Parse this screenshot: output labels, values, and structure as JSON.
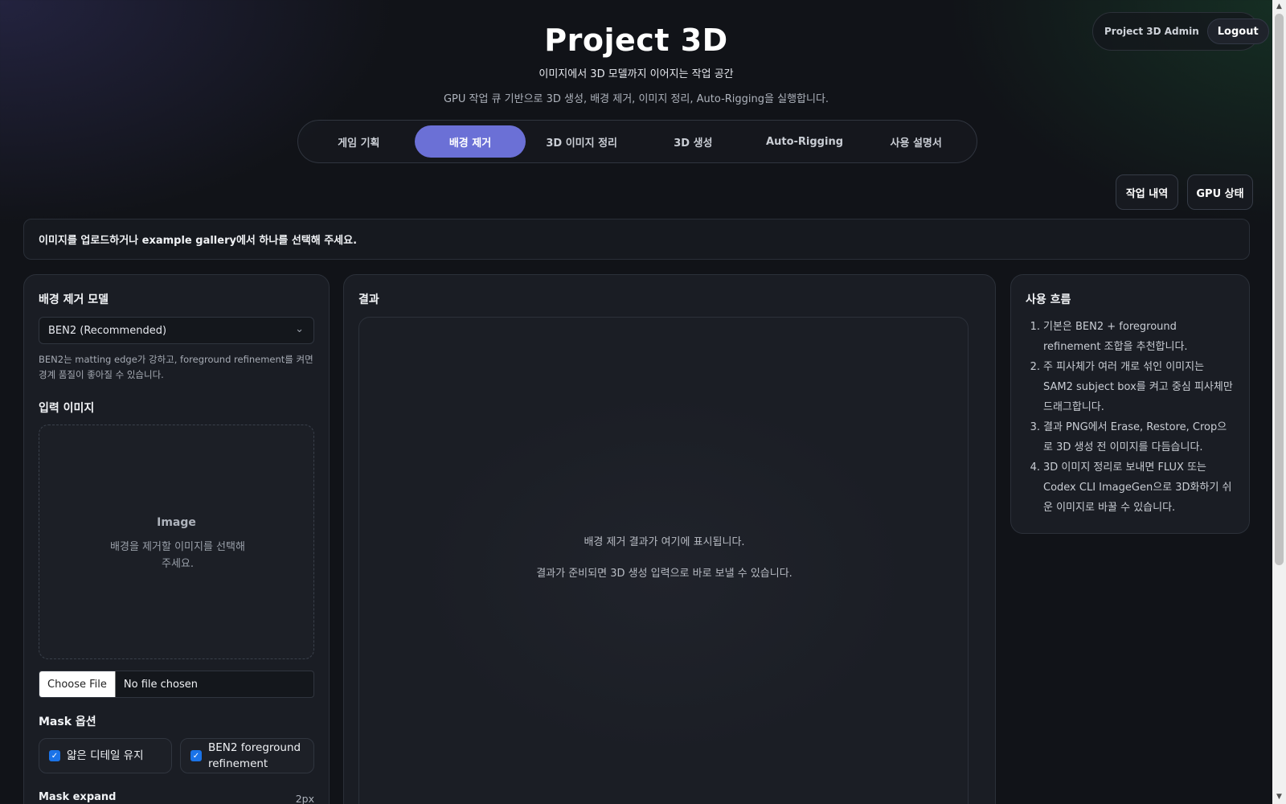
{
  "header": {
    "title": "Project 3D",
    "subtitle": "이미지에서 3D 모델까지 이어지는 작업 공간",
    "description": "GPU 작업 큐 기반으로 3D 생성, 배경 제거, 이미지 정리, Auto-Rigging을 실행합니다."
  },
  "user": {
    "name": "Project 3D Admin",
    "logout_label": "Logout"
  },
  "tabs": [
    {
      "label": "게임 기획",
      "active": false
    },
    {
      "label": "배경 제거",
      "active": true
    },
    {
      "label": "3D 이미지 정리",
      "active": false
    },
    {
      "label": "3D 생성",
      "active": false
    },
    {
      "label": "Auto-Rigging",
      "active": false
    },
    {
      "label": "사용 설명서",
      "active": false
    }
  ],
  "toolbar": {
    "jobs_label": "작업 내역",
    "gpu_label": "GPU 상태"
  },
  "notice": "이미지를 업로드하거나 example gallery에서 하나를 선택해 주세요.",
  "left_panel": {
    "model_title": "배경 제거 모델",
    "model_selected": "BEN2 (Recommended)",
    "model_hint": "BEN2는 matting edge가 강하고, foreground refinement를 켜면 경계 품질이 좋아질 수 있습니다.",
    "input_title": "입력 이미지",
    "dropzone_title": "Image",
    "dropzone_text": "배경을 제거할 이미지를 선택해 주세요.",
    "file_button": "Choose File",
    "file_status": "No file chosen",
    "mask_title": "Mask 옵션",
    "options": [
      {
        "label": "얇은 디테일 유지",
        "checked": true
      },
      {
        "label": "BEN2 foreground refinement",
        "checked": true
      }
    ],
    "expand_label": "Mask expand",
    "expand_value": "2px"
  },
  "result_panel": {
    "title": "결과",
    "placeholder_line1": "배경 제거 결과가 여기에 표시됩니다.",
    "placeholder_line2": "결과가 준비되면 3D 생성 입력으로 바로 보낼 수 있습니다."
  },
  "flow_panel": {
    "title": "사용 흐름",
    "steps": [
      {
        "num": "1.",
        "text": "기본은 BEN2 + foreground refinement 조합을 추천합니다."
      },
      {
        "num": "2.",
        "text": "주 피사체가 여러 개로 섞인 이미지는 SAM2 subject box를 켜고 중심 피사체만 드래그합니다."
      },
      {
        "num": "3.",
        "text": "결과 PNG에서 Erase, Restore, Crop으로 3D 생성 전 이미지를 다듬습니다."
      },
      {
        "num": "4.",
        "text": "3D 이미지 정리로 보내면 FLUX 또는 Codex CLI ImageGen으로 3D화하기 쉬운 이미지로 바꿀 수 있습니다."
      }
    ]
  },
  "colors": {
    "accent": "#6b70d6",
    "checkbox": "#1a73e8",
    "panel": "#1a1d24",
    "background": "#111318"
  },
  "icons": {
    "select_arrow": "chevron-down-icon",
    "checkbox": "check-icon"
  }
}
